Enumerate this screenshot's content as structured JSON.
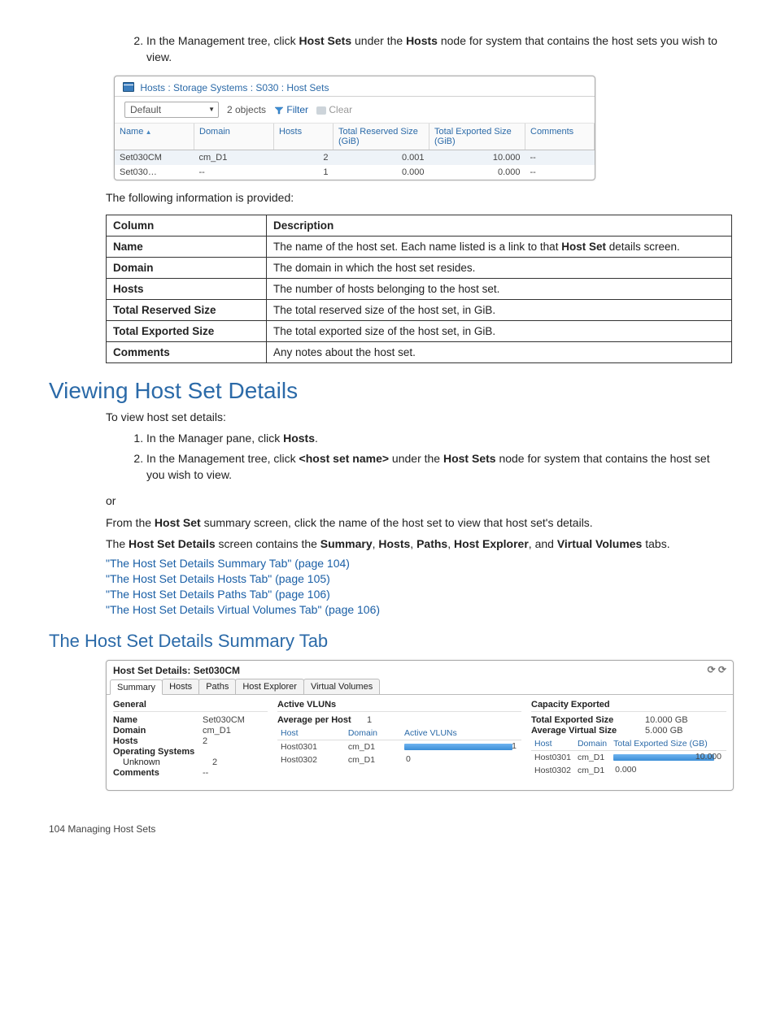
{
  "step2_prefix": "In the Management tree, click ",
  "step2_bold1": "Host Sets",
  "step2_mid": " under the ",
  "step2_bold2": "Hosts",
  "step2_suffix": " node for system that contains the host sets you wish to view.",
  "sc1": {
    "breadcrumb": "Hosts : Storage Systems : S030 : Host Sets",
    "dropdown": "Default",
    "objects": "2 objects",
    "filter": "Filter",
    "clear": "Clear",
    "cols": {
      "name": "Name",
      "domain": "Domain",
      "hosts": "Hosts",
      "reserved": "Total Reserved Size (GiB)",
      "exported": "Total Exported Size (GiB)",
      "comments": "Comments"
    },
    "rows": [
      {
        "name": "Set030CM",
        "domain": "cm_D1",
        "hosts": "2",
        "reserved": "0.001",
        "exported": "10.000",
        "comments": "--"
      },
      {
        "name": "Set030…",
        "domain": "--",
        "hosts": "1",
        "reserved": "0.000",
        "exported": "0.000",
        "comments": "--"
      }
    ]
  },
  "following_info": "The following information is provided:",
  "info_table": {
    "col1": "Column",
    "col2": "Description",
    "rows": [
      {
        "c": "Name",
        "d_pre": "The name of the host set. Each name listed is a link to that ",
        "d_b": "Host Set",
        "d_post": " details screen."
      },
      {
        "c": "Domain",
        "d": "The domain in which the host set resides."
      },
      {
        "c": "Hosts",
        "d": "The number of hosts belonging to the host set."
      },
      {
        "c": "Total Reserved Size",
        "d": "The total reserved size of the host set, in GiB."
      },
      {
        "c": "Total Exported Size",
        "d": "The total exported size of the host set, in GiB."
      },
      {
        "c": "Comments",
        "d": "Any notes about the host set."
      }
    ]
  },
  "h1": "Viewing Host Set Details",
  "intro": "To view host set details:",
  "vstep1_pre": "In the Manager pane, click ",
  "vstep1_b": "Hosts",
  "vstep1_post": ".",
  "vstep2_pre": "In the Management tree, click ",
  "vstep2_b": "<host set name>",
  "vstep2_mid": " under the ",
  "vstep2_b2": "Host Sets",
  "vstep2_post": " node for system that contains the host set you wish to view.",
  "or": "or",
  "from_p_pre": "From the ",
  "from_p_b": "Host Set",
  "from_p_post": " summary screen, click the name of the host set to view that host set's details.",
  "contains_pre": "The ",
  "contains_b1": "Host Set Details",
  "contains_mid1": " screen contains the ",
  "contains_b2": "Summary",
  "contains_c": ", ",
  "contains_b3": "Hosts",
  "contains_b4": "Paths",
  "contains_b5": "Host Explorer",
  "contains_and": ", and ",
  "contains_b6": "Virtual Volumes",
  "contains_post": " tabs.",
  "links": [
    "\"The Host Set Details Summary Tab\" (page 104)",
    "\"The Host Set Details Hosts Tab\" (page 105)",
    "\"The Host Set Details Paths Tab\" (page 106)",
    "\"The Host Set Details Virtual Volumes Tab\" (page 106)"
  ],
  "h2": "The Host Set Details Summary Tab",
  "sc2": {
    "title": "Host Set Details: Set030CM",
    "refresh": "⟳  ⟳",
    "tabs": [
      "Summary",
      "Hosts",
      "Paths",
      "Host Explorer",
      "Virtual Volumes"
    ],
    "general_h": "General",
    "general": [
      {
        "k": "Name",
        "v": "Set030CM"
      },
      {
        "k": "Domain",
        "v": "cm_D1"
      },
      {
        "k": "Hosts",
        "v": "2"
      },
      {
        "k": "Operating Systems",
        "v": ""
      },
      {
        "k": "Unknown",
        "v": "2",
        "indent": true
      },
      {
        "k": "Comments",
        "v": "--"
      }
    ],
    "vluns_h": "Active VLUNs",
    "avg_k": "Average per Host",
    "avg_v": "1",
    "vluns_cols": [
      "Host",
      "Domain",
      "Active VLUNs"
    ],
    "vluns_rows": [
      {
        "host": "Host0301",
        "domain": "cm_D1",
        "val": "1",
        "pct": 100
      },
      {
        "host": "Host0302",
        "domain": "cm_D1",
        "val": "0",
        "pct": 0
      }
    ],
    "cap_h": "Capacity Exported",
    "cap_kv": [
      {
        "k": "Total Exported Size",
        "v": "10.000 GB"
      },
      {
        "k": "Average Virtual Size",
        "v": "5.000 GB"
      }
    ],
    "cap_cols": [
      "Host",
      "Domain",
      "Total Exported Size (GB)"
    ],
    "cap_rows": [
      {
        "host": "Host0301",
        "domain": "cm_D1",
        "val": "10.000",
        "pct": 100
      },
      {
        "host": "Host0302",
        "domain": "cm_D1",
        "val": "0.000",
        "pct": 0
      }
    ]
  },
  "footer": "104   Managing Host Sets"
}
